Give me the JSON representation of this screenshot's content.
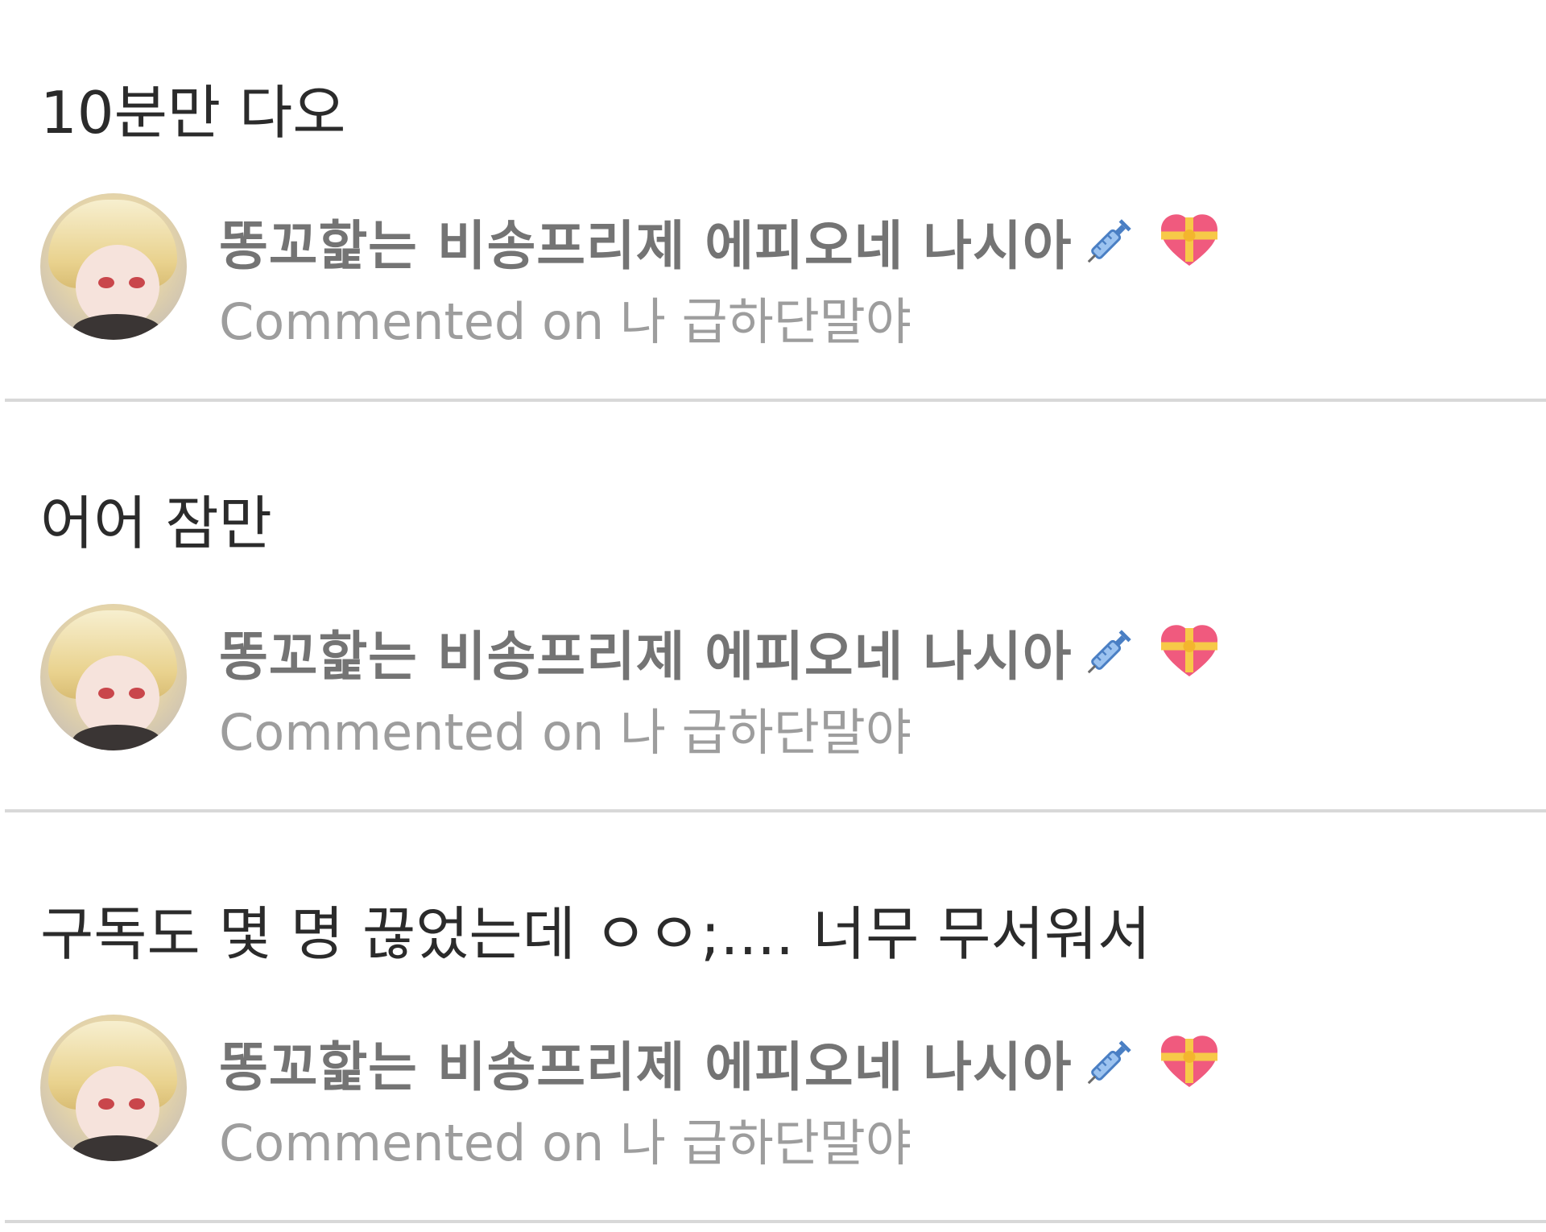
{
  "comments": [
    {
      "text": "10분만 다오",
      "author": "똥꼬핥는 비송프리제 에피오네 나시아",
      "author_icons": [
        "syringe-icon",
        "heart-with-ribbon-icon"
      ],
      "commented_prefix": "Commented on",
      "post_title": "나 급하단말야"
    },
    {
      "text": "어어 잠만",
      "author": "똥꼬핥는 비송프리제 에피오네 나시아",
      "author_icons": [
        "syringe-icon",
        "heart-with-ribbon-icon"
      ],
      "commented_prefix": "Commented on",
      "post_title": "나 급하단말야"
    },
    {
      "text": "구독도 몇 명 끊었는데 ㅇㅇ;.... 너무 무서워서",
      "author": "똥꼬핥는 비송프리제 에피오네 나시아",
      "author_icons": [
        "syringe-icon",
        "heart-with-ribbon-icon"
      ],
      "commented_prefix": "Commented on",
      "post_title": "나 급하단말야"
    }
  ],
  "colors": {
    "comment_text": "#2b2b2b",
    "author_text": "#747474",
    "meta_text": "#9d9d9d",
    "divider": "#d8d8d8",
    "background": "#ffffff"
  }
}
